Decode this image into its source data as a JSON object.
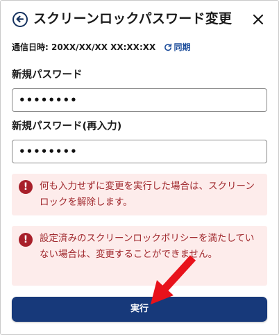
{
  "header": {
    "title": "スクリーンロックパスワード変更",
    "back_icon": "arrow-left-circle-icon",
    "close_icon": "close-icon"
  },
  "sync": {
    "label": "通信日時: 20XX/XX/XX XX:XX:XX",
    "link_label": "同期",
    "icon": "refresh-icon"
  },
  "form": {
    "new_password_label": "新規パスワード",
    "new_password_value": "••••••••",
    "confirm_password_label": "新規パスワード(再入力)",
    "confirm_password_value": "••••••••"
  },
  "alerts": [
    {
      "icon": "exclamation-circle-icon",
      "text": "何も入力せずに変更を実行した場合は、スクリーンロックを解除します。"
    },
    {
      "icon": "exclamation-circle-icon",
      "text": "設定済みのスクリーンロックポリシーを満たしていない場合は、変更することができません。"
    }
  ],
  "submit": {
    "label": "実行"
  },
  "colors": {
    "primary": "#17397a",
    "link": "#1f4f9c",
    "alert_bg": "#fdeceb",
    "alert_text": "#a12a2f",
    "alert_icon": "#a8202a",
    "annotation_arrow": "#e8121b"
  }
}
